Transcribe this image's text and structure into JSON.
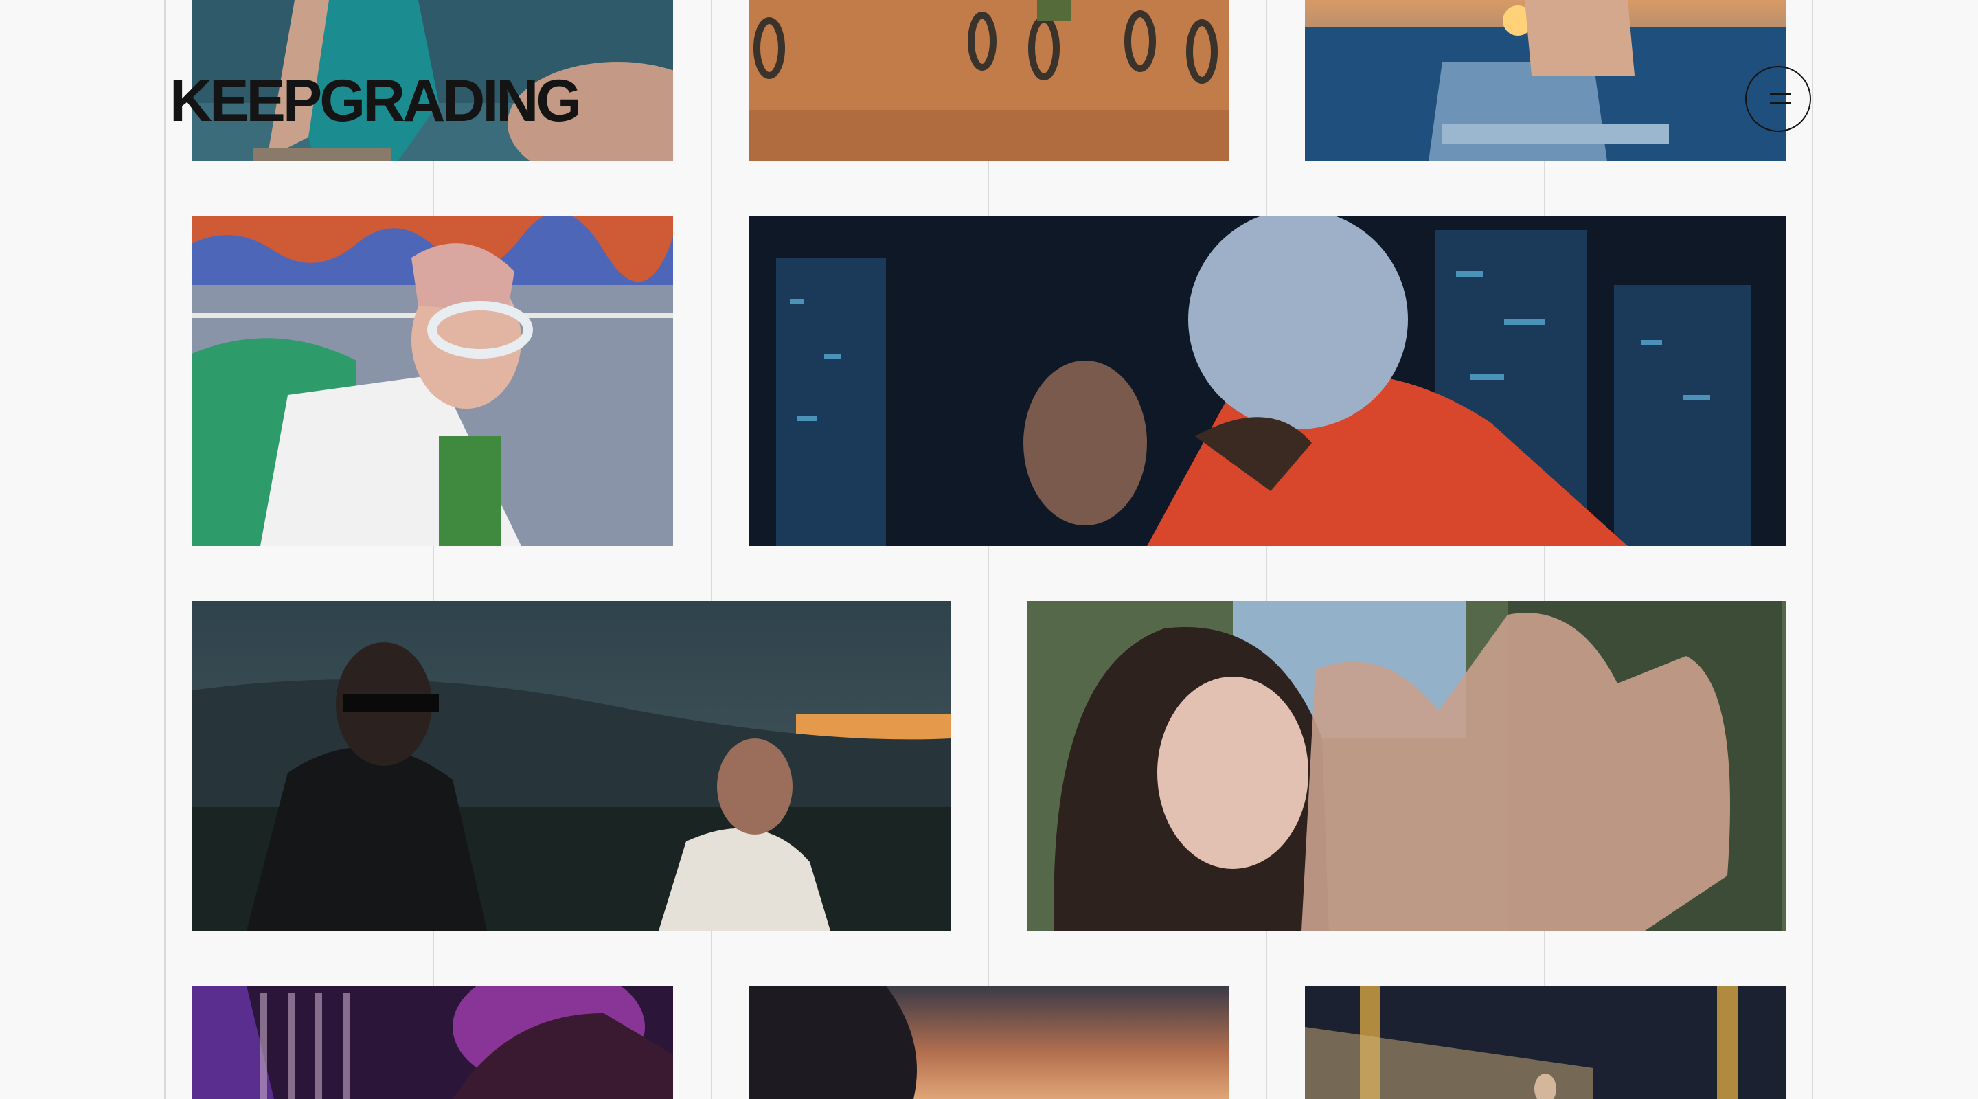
{
  "header": {
    "logo_text": "KEEPGRADING",
    "menu_icon": "hamburger-icon"
  },
  "gallery": {
    "tiles": [
      {
        "id": "swimsuit-sea",
        "palette": [
          "#2e5d6e",
          "#1d8a8f",
          "#c79b85"
        ]
      },
      {
        "id": "bikes-dirt-road",
        "palette": [
          "#c07a48",
          "#9a5a33",
          "#4a3b30"
        ]
      },
      {
        "id": "sunset-sea-chair",
        "palette": [
          "#1f4e7a",
          "#d8a070",
          "#7a9fbd"
        ]
      },
      {
        "id": "street-glasses",
        "palette": [
          "#8c97ab",
          "#2e9a6a",
          "#e36b3c"
        ]
      },
      {
        "id": "night-city-mask",
        "palette": [
          "#0d1a2a",
          "#d5462a",
          "#9fb0c9"
        ]
      },
      {
        "id": "sunset-hills-duo",
        "palette": [
          "#1c2a33",
          "#394a52",
          "#e39a4b"
        ]
      },
      {
        "id": "woman-hands-forest",
        "palette": [
          "#3c4a33",
          "#c99a86",
          "#87a7c2"
        ]
      },
      {
        "id": "purple-club",
        "palette": [
          "#3a1d4e",
          "#a23fb0",
          "#2a1533"
        ]
      },
      {
        "id": "dusk-silhouette",
        "palette": [
          "#2a2733",
          "#b57055",
          "#e4a57a"
        ]
      },
      {
        "id": "hall-light",
        "palette": [
          "#1a1f2a",
          "#c9a45a",
          "#3a3f4a"
        ]
      }
    ]
  }
}
